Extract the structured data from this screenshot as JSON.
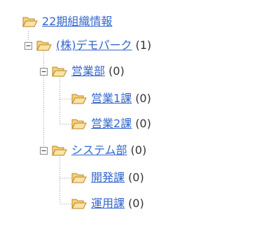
{
  "tree": {
    "root": {
      "label": "22期組織情報",
      "icon": "folder-open-icon"
    },
    "company": {
      "label": "(株)デモパーク",
      "count": "(1)",
      "toggle": "collapse-minus-icon",
      "icon": "folder-open-icon"
    },
    "departments": [
      {
        "label": "営業部",
        "count": "(0)",
        "toggle": "collapse-minus-icon",
        "icon": "folder-open-icon",
        "sections": [
          {
            "label": "営業1課",
            "count": "(0)",
            "icon": "folder-open-icon"
          },
          {
            "label": "営業2課",
            "count": "(0)",
            "icon": "folder-open-icon"
          }
        ]
      },
      {
        "label": "システム部",
        "count": "(0)",
        "toggle": "collapse-minus-icon",
        "icon": "folder-open-icon",
        "sections": [
          {
            "label": "開発課",
            "count": "(0)",
            "icon": "folder-open-icon"
          },
          {
            "label": "運用課",
            "count": "(0)",
            "icon": "folder-open-icon"
          }
        ]
      }
    ]
  },
  "colors": {
    "link": "#3366cc",
    "folder_fill": "#f7d27a",
    "folder_stroke": "#b8862b",
    "connector": "#9a9a9a"
  }
}
